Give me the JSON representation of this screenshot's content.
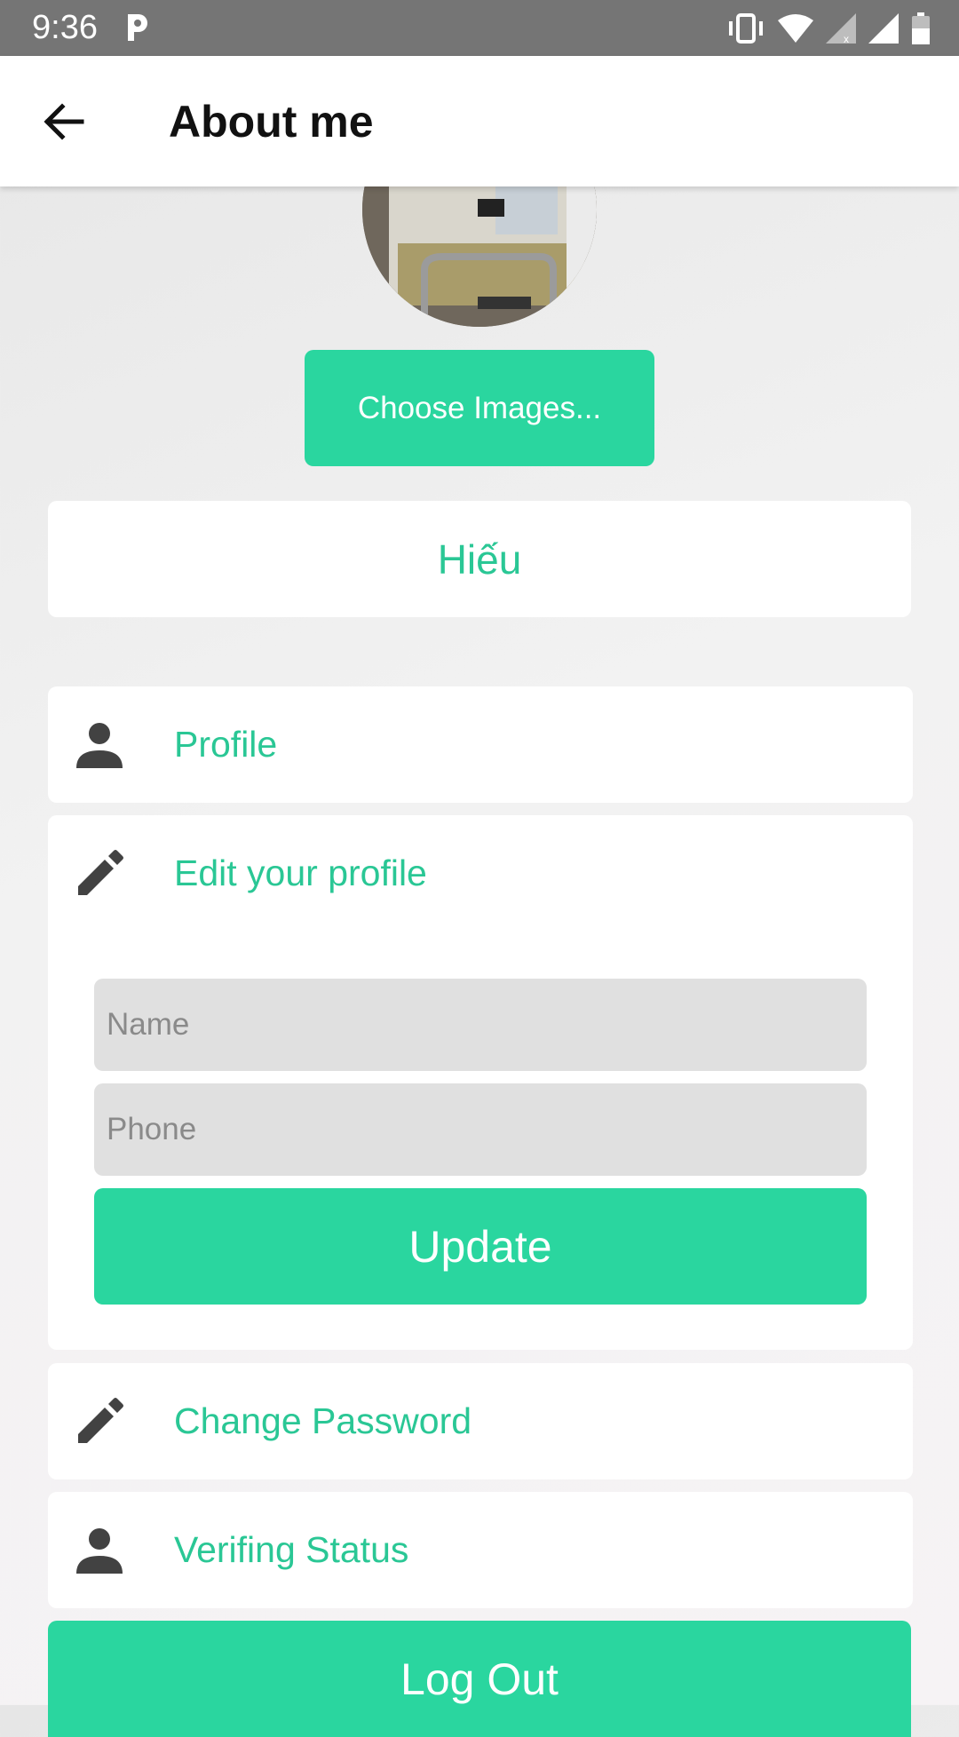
{
  "status_bar": {
    "time": "9:36",
    "icons": [
      "p-app-icon",
      "vibrate-icon",
      "wifi-icon",
      "signal-off-icon",
      "signal-icon",
      "battery-icon"
    ]
  },
  "app_bar": {
    "title": "About me",
    "back_icon": "arrow-back-icon"
  },
  "avatar": {
    "icon": "avatar-photo"
  },
  "choose_images_label": "Choose Images...",
  "user_name": "Hiếu",
  "menu": {
    "profile": {
      "label": "Profile",
      "icon": "person-icon"
    },
    "edit_profile": {
      "label": "Edit your profile",
      "icon": "pencil-icon"
    },
    "change_password": {
      "label": "Change Password",
      "icon": "pencil-icon"
    },
    "verifing_status": {
      "label": "Verifing Status",
      "icon": "person-icon"
    }
  },
  "edit_form": {
    "name_placeholder": "Name",
    "name_value": "",
    "phone_placeholder": "Phone",
    "phone_value": "",
    "update_label": "Update"
  },
  "logout_label": "Log Out",
  "colors": {
    "accent": "#2ad69f",
    "accent_text": "#2ac795",
    "status_bar": "#757575",
    "input_bg": "#e0e0e0"
  }
}
